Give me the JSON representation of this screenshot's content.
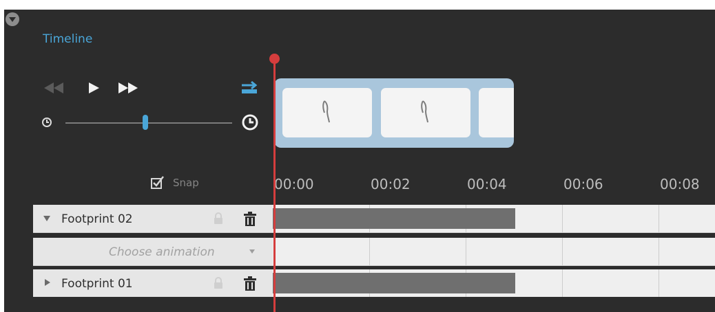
{
  "panel": {
    "title": "Timeline"
  },
  "controls": {
    "rewind_icon": "rewind-icon",
    "play_icon": "play-icon",
    "fast_forward_icon": "fast-forward-icon",
    "loop_icon": "loop-icon",
    "speed_slider": {
      "min_icon": "clock-icon",
      "max_icon": "clock-icon",
      "value": 0.48
    }
  },
  "preview": {
    "frames": [
      "footprint",
      "footprint",
      "footprint"
    ]
  },
  "snap": {
    "label": "Snap",
    "checked": true
  },
  "ruler": {
    "ticks": [
      "00:00",
      "00:02",
      "00:04",
      "00:06",
      "00:08"
    ]
  },
  "tracks": [
    {
      "name": "Footprint 02",
      "expanded": true,
      "clip_end": "00:04"
    },
    {
      "name": "Choose animation"
    },
    {
      "name": "Footprint 01",
      "expanded": false,
      "clip_end": "00:04"
    }
  ],
  "colors": {
    "accent": "#4aa6d8",
    "playhead": "#d53d3d",
    "panel_bg": "#2c2c2c"
  }
}
